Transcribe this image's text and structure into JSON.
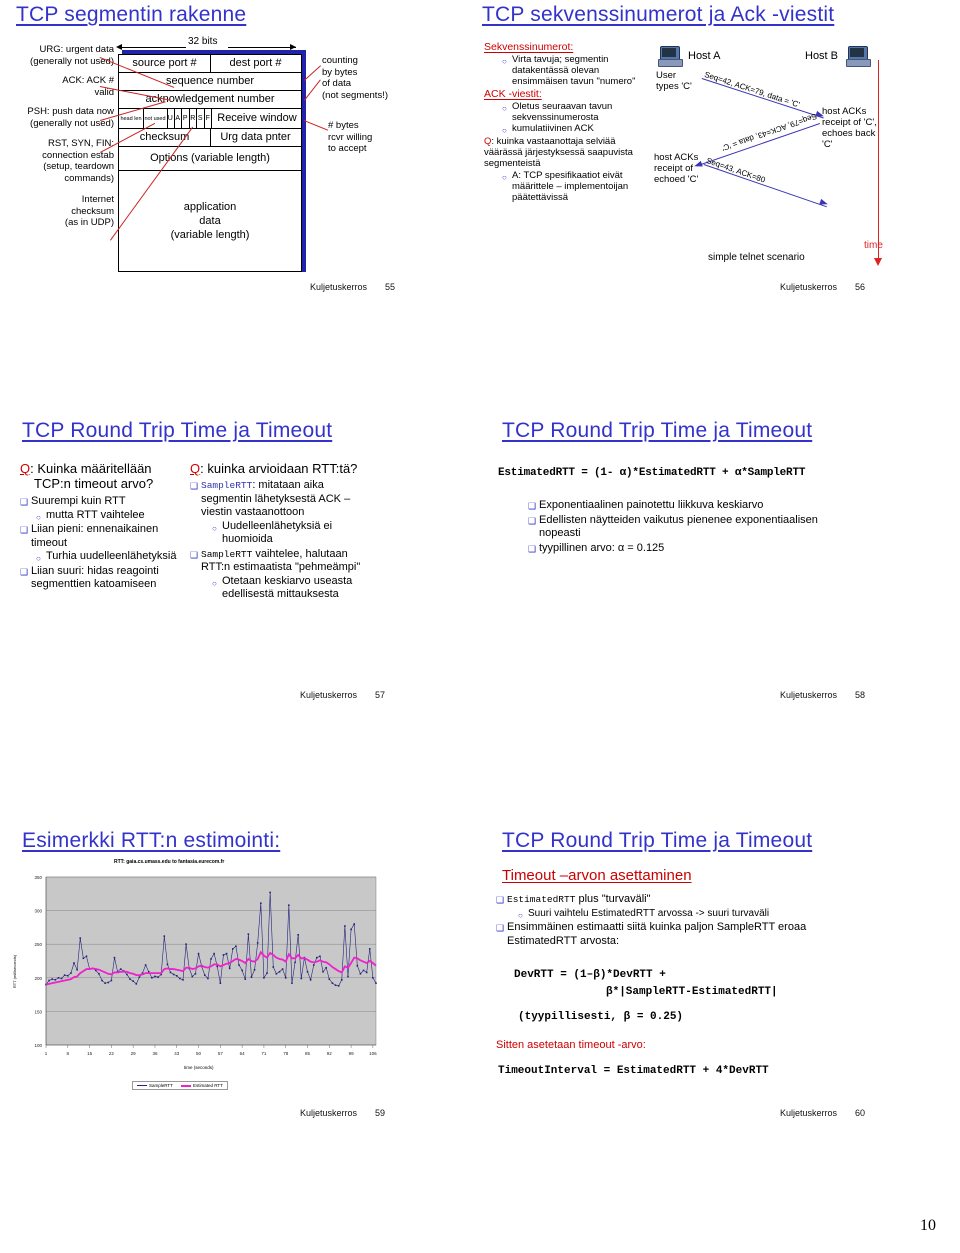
{
  "page": {
    "number": "10"
  },
  "slides": [
    {
      "id": "tcp-segment-structure",
      "title": "TCP segmentin rakenne",
      "footer_label": "Kuljetuskerros",
      "footer_page": "55",
      "bits_label": "32 bits",
      "left_annotations": [
        "URG: urgent data",
        "(generally not used)",
        "ACK: ACK #",
        "valid",
        "PSH: push data now",
        "(generally not used)",
        "RST, SYN, FIN:",
        "connection estab",
        "(setup, teardown",
        "commands)",
        "Internet",
        "checksum",
        "(as in UDP)"
      ],
      "right_annotations": [
        "counting",
        "by bytes",
        "of data",
        "(not segments!)",
        "# bytes",
        "rcvr willing",
        "to accept"
      ],
      "header_fields": {
        "source_port": "source port #",
        "dest_port": "dest port #",
        "sequence_number": "sequence number",
        "ack_number": "acknowledgement number",
        "head_len": "head len",
        "not_used": "not used",
        "flags": [
          "U",
          "A",
          "P",
          "R",
          "S",
          "F"
        ],
        "receive_window": "Receive window",
        "checksum": "checksum",
        "urg_pointer": "Urg data pnter",
        "options": "Options (variable length)",
        "application_data": [
          "application",
          "data",
          "(variable length)"
        ]
      }
    },
    {
      "id": "tcp-seq-ack",
      "title": "TCP sekvenssinumerot ja Ack -viestit",
      "footer_label": "Kuljetuskerros",
      "footer_page": "56",
      "section1_head": "Sekvenssinumerot:",
      "section1_items": [
        "Virta tavuja; segmentin datakentässä olevan ensimmäisen tavun \"numero\""
      ],
      "section2_head": "ACK -viestit:",
      "section2_items": [
        "Oletus seuraavan tavun sekvenssinumerosta",
        "kumulatiivinen ACK"
      ],
      "question_prefix": "Q",
      "question": ": kuinka vastaanottaja selviää väärässä järjestyksessä saapuvista segmenteistä",
      "answer": "A: TCP spesifikaatiot eivät määrittele – implementoijan päätettävissä",
      "diagram": {
        "host_a": "Host A",
        "host_b": "Host B",
        "note_a": "User types 'C'",
        "note_b": "host ACKs receipt of 'C', echoes back 'C'",
        "note_c": "host ACKs receipt of echoed 'C'",
        "msg1": "Seq=42, ACK=79, data = 'C'",
        "msg2": "Seq=79, ACK=43, data = 'C'",
        "msg3": "Seq=43, ACK=80",
        "time_label": "time",
        "caption": "simple telnet scenario"
      }
    },
    {
      "id": "tcp-rtt-timeout-1",
      "title": "TCP Round Trip Time ja Timeout",
      "footer_label": "Kuljetuskerros",
      "footer_page": "57",
      "col_left": {
        "q_prefix": "Q",
        "q_text": ": Kuinka määritellään TCP:n timeout arvo?",
        "items": [
          {
            "level": 1,
            "text": "Suurempi kuin RTT"
          },
          {
            "level": 2,
            "text": "mutta RTT vaihtelee"
          },
          {
            "level": 1,
            "text": "Liian pieni: ennenaikainen timeout"
          },
          {
            "level": 2,
            "text": "Turhia uudelleenlähetyksiä"
          },
          {
            "level": 1,
            "text": "Liian suuri: hidas reagointi segmenttien katoamiseen"
          }
        ]
      },
      "col_right": {
        "q_prefix": "Q",
        "q_text": ": kuinka arvioidaan RTT:tä?",
        "items": [
          {
            "level": 1,
            "mono": "SampleRTT",
            "text": ": mitataan aika segmentin lähetyksestä ACK – viestin vastaanottoon"
          },
          {
            "level": 2,
            "mono": "",
            "text": "Uudelleenlähetyksiä ei huomioida"
          },
          {
            "level": 1,
            "mono": "SampleRTT",
            "text": " vaihtelee, halutaan RTT:n estimaatista \"pehmeämpi\""
          },
          {
            "level": 2,
            "mono": "",
            "text": "Otetaan keskiarvo useasta edellisestä mittauksesta"
          }
        ]
      }
    },
    {
      "id": "tcp-rtt-timeout-2",
      "title": "TCP Round Trip Time ja Timeout",
      "footer_label": "Kuljetuskerros",
      "footer_page": "58",
      "formula": "EstimatedRTT = (1- α)*EstimatedRTT + α*SampleRTT",
      "items": [
        "Exponentiaalinen painotettu liikkuva keskiarvo",
        "Edellisten näytteiden vaikutus pienenee exponentiaalisen nopeasti",
        "tyypillinen arvo: α  = 0.125"
      ]
    },
    {
      "id": "rtt-estimation-example",
      "title": "Esimerkki RTT:n estimointi:",
      "footer_label": "Kuljetuskerros",
      "footer_page": "59"
    },
    {
      "id": "tcp-rtt-timeout-3",
      "title": "TCP Round Trip Time ja Timeout",
      "subtitle": "Timeout –arvon asettaminen",
      "footer_label": "Kuljetuskerros",
      "footer_page": "60",
      "items": [
        {
          "level": 1,
          "mono": "EstimatedRTT",
          "text": " plus \"turvaväli\""
        },
        {
          "level": 2,
          "mono": "",
          "text": "Suuri vaihtelu EstimatedRTT arvossa -> suuri turvaväli"
        },
        {
          "level": 1,
          "mono": "",
          "text": "Ensimmäinen estimaatti siitä kuinka paljon SampleRTT eroaa EstimatedRTT arvosta:"
        }
      ],
      "formula1_line1": "DevRTT = (1–β)*DevRTT +",
      "formula1_line2": "β*|SampleRTT-EstimatedRTT|",
      "formula2": "(tyypillisesti, β = 0.25)",
      "red_note": "Sitten asetetaan timeout -arvo:",
      "formula3": "TimeoutInterval = EstimatedRTT + 4*DevRTT"
    }
  ],
  "chart_data": {
    "type": "line",
    "title": "RTT: gaia.cs.umass.edu to fantasia.eurecom.fr",
    "xlabel": "time (seconds)",
    "ylabel": "RTT (milliseconds)",
    "ylim": [
      100,
      350
    ],
    "yticks": [
      100,
      150,
      200,
      250,
      300,
      350
    ],
    "xticks": [
      1,
      8,
      15,
      22,
      29,
      36,
      43,
      50,
      57,
      64,
      71,
      78,
      85,
      92,
      99,
      106
    ],
    "xlim": [
      1,
      112
    ],
    "grid": true,
    "legend_position": "bottom",
    "plot_bg": "#c8c8c8",
    "series": [
      {
        "name": "SampleRTT",
        "color": "#23237a",
        "marker": "diamond",
        "values": [
          190,
          196,
          198,
          197,
          200,
          199,
          204,
          203,
          207,
          222,
          212,
          259,
          229,
          232,
          213,
          214,
          211,
          206,
          196,
          192,
          193,
          196,
          230,
          209,
          213,
          210,
          205,
          198,
          195,
          191,
          201,
          207,
          219,
          209,
          200,
          202,
          201,
          205,
          262,
          220,
          208,
          205,
          203,
          199,
          197,
          250,
          214,
          202,
          206,
          236,
          217,
          204,
          199,
          228,
          236,
          217,
          192,
          234,
          236,
          214,
          243,
          247,
          219,
          211,
          198,
          265,
          201,
          212,
          252,
          311,
          200,
          207,
          327,
          216,
          206,
          209,
          213,
          200,
          308,
          192,
          223,
          264,
          199,
          230,
          209,
          197,
          219,
          230,
          232,
          209,
          215,
          198,
          192,
          189,
          188,
          197,
          277,
          202,
          272,
          280,
          218,
          206,
          211,
          208,
          243,
          200,
          192
        ]
      },
      {
        "name": "Estimated RTT",
        "color": "#ee22cc",
        "marker": "square",
        "values": [
          190,
          191,
          192,
          193,
          194,
          195,
          196,
          197,
          198,
          201,
          202,
          207,
          210,
          213,
          213,
          214,
          213,
          212,
          210,
          208,
          206,
          205,
          208,
          208,
          209,
          209,
          209,
          207,
          206,
          204,
          204,
          205,
          207,
          207,
          207,
          207,
          207,
          207,
          213,
          214,
          213,
          213,
          212,
          211,
          210,
          215,
          215,
          213,
          214,
          217,
          218,
          216,
          215,
          217,
          220,
          220,
          217,
          219,
          221,
          222,
          225,
          228,
          227,
          225,
          222,
          228,
          225,
          224,
          228,
          238,
          233,
          230,
          237,
          234,
          230,
          228,
          227,
          224,
          235,
          229,
          229,
          234,
          229,
          229,
          227,
          224,
          223,
          224,
          226,
          224,
          223,
          220,
          216,
          213,
          210,
          208,
          217,
          215,
          222,
          230,
          229,
          226,
          224,
          222,
          225,
          222,
          218
        ]
      }
    ]
  }
}
